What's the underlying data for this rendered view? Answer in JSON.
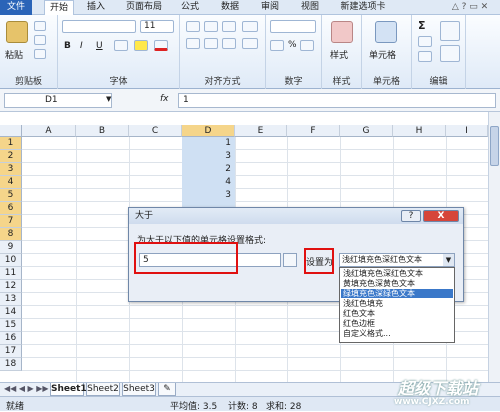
{
  "ribbon_tabs": [
    "文件",
    "开始",
    "插入",
    "页面布局",
    "公式",
    "数据",
    "审阅",
    "视图",
    "新建选项卡"
  ],
  "groups": {
    "clipboard": "剪贴板",
    "font": "字体",
    "alignment": "对齐方式",
    "number": "数字",
    "styles": "样式",
    "cells": "单元格",
    "editing": "编辑"
  },
  "ribbon_labels": {
    "paste": "粘贴",
    "font_size": "11",
    "number_format": "%",
    "styles_btn": "样式",
    "cells_btn": "单元格",
    "sum": "Σ",
    "bold": "B",
    "italic": "I",
    "underline": "U"
  },
  "formula_bar": {
    "name_box": "D1",
    "fx": "fx",
    "content": "1"
  },
  "columns": [
    "A",
    "B",
    "C",
    "D",
    "E",
    "F",
    "G",
    "H",
    "I"
  ],
  "rows": [
    "1",
    "2",
    "3",
    "4",
    "5",
    "6",
    "7",
    "8",
    "9",
    "10",
    "11",
    "12",
    "13",
    "14",
    "15",
    "16",
    "17",
    "18"
  ],
  "d_values": [
    "1",
    "3",
    "2",
    "4",
    "3",
    "",
    "",
    ""
  ],
  "sheet_tabs": [
    "Sheet1",
    "Sheet2",
    "Sheet3"
  ],
  "status": {
    "ready": "就绪",
    "average": "平均值: 3.5",
    "count": "计数: 8",
    "sum": "求和: 28"
  },
  "dialog": {
    "title": "大于",
    "help": "?",
    "close": "X",
    "prompt": "为大于以下值的单元格设置格式:",
    "value": "5",
    "set_as": "设置为",
    "selected": "浅红填充色深红色文本",
    "options": [
      "浅红填充色深红色文本",
      "黄填充色深黄色文本",
      "绿填充色深绿色文本",
      "浅红色填充",
      "红色文本",
      "红色边框",
      "自定义格式..."
    ]
  },
  "watermark": {
    "brand": "超级下载站",
    "url": "www.CJXZ.com"
  },
  "colors": {
    "accent_blue": "#2a64b8",
    "highlight_red": "#e01010",
    "selected_cell": "#cfe0f3",
    "selected_option": "#3a78c9"
  }
}
